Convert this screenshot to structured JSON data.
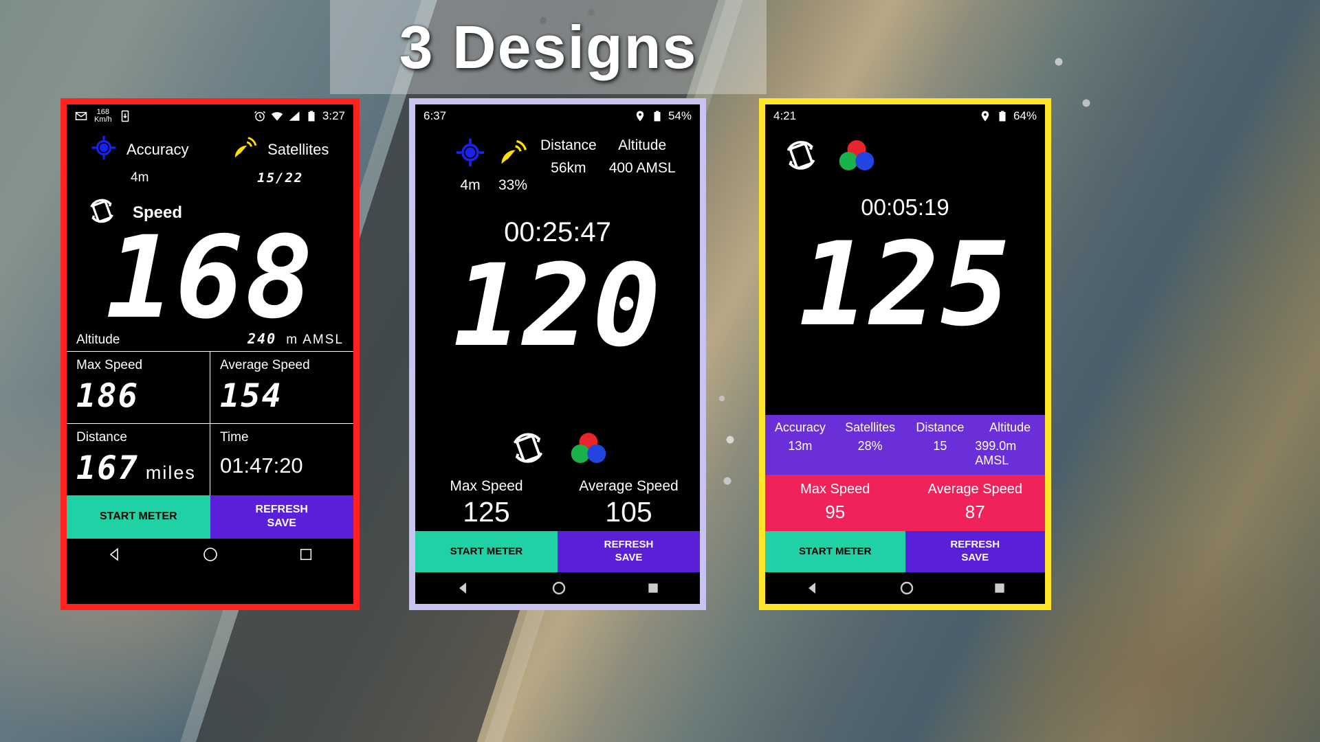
{
  "banner": {
    "title": "3 Designs"
  },
  "colors": {
    "phone1_frame": "#ff2320",
    "phone2_frame": "#c9c3f2",
    "phone3_frame": "#ffe428",
    "teal_button": "#1fd1a5",
    "purple_button": "#5a1fd8",
    "panel_purple": "#6a2fd8",
    "panel_pink": "#f0225a",
    "gps_blue": "#1a22f0",
    "satellite_yellow": "#ffe000"
  },
  "phone1": {
    "statusbar": {
      "mail_icon": "mail-icon",
      "speed_badge": "168",
      "speed_unit": "Km/h",
      "download_icon": "download-icon",
      "alarm_icon": "alarm-icon",
      "wifi_icon": "wifi-icon",
      "signal_icon": "signal-icon",
      "battery_icon": "battery-icon",
      "time": "3:27"
    },
    "accuracy": {
      "icon": "gps-target-icon",
      "label": "Accuracy",
      "value": "4m"
    },
    "satellites": {
      "icon": "satellite-dish-icon",
      "label": "Satellites",
      "value": "15/22"
    },
    "speed": {
      "icon": "rotate-device-icon",
      "label": "Speed",
      "value": "168"
    },
    "altitude": {
      "label": "Altitude",
      "value": "240",
      "unit": "m AMSL"
    },
    "stats": [
      {
        "label": "Max Speed",
        "value": "186",
        "unit": ""
      },
      {
        "label": "Average Speed",
        "value": "154",
        "unit": ""
      },
      {
        "label": "Distance",
        "value": "167",
        "unit": "miles"
      },
      {
        "label": "Time",
        "value": "01:47:20",
        "unit": ""
      }
    ],
    "buttons": [
      {
        "label": "START METER",
        "style": "teal"
      },
      {
        "label": "REFRESH\nSAVE",
        "line1": "REFRESH",
        "line2": "SAVE",
        "style": "purple"
      }
    ],
    "navbar": [
      "back-icon",
      "home-icon",
      "recents-icon"
    ]
  },
  "phone2": {
    "statusbar": {
      "time": "6:37",
      "location_icon": "location-pin-icon",
      "battery_icon": "battery-icon",
      "battery": "54%"
    },
    "accuracy": {
      "icon": "gps-target-icon",
      "value": "4m"
    },
    "satellites": {
      "icon": "satellite-dish-icon",
      "value": "33%"
    },
    "distance": {
      "label": "Distance",
      "value": "56km"
    },
    "altitude": {
      "label": "Altitude",
      "value": "400 AMSL"
    },
    "timer": "00:25:47",
    "speed": "120",
    "icons": {
      "rotate": "rotate-device-icon",
      "color_dots": "color-mode-icon"
    },
    "stats": [
      {
        "label": "Max Speed",
        "value": "125"
      },
      {
        "label": "Average Speed",
        "value": "105"
      }
    ],
    "buttons": [
      {
        "label": "START METER",
        "style": "teal"
      },
      {
        "line1": "REFRESH",
        "line2": "SAVE",
        "style": "purple"
      }
    ],
    "navbar": [
      "back-icon",
      "home-icon",
      "recents-icon"
    ]
  },
  "phone3": {
    "statusbar": {
      "time": "4:21",
      "location_icon": "location-pin-icon",
      "battery_icon": "battery-icon",
      "battery": "64%"
    },
    "icons": {
      "rotate": "rotate-device-icon",
      "color_dots": "color-mode-icon"
    },
    "timer": "00:05:19",
    "speed": "125",
    "info": [
      {
        "label": "Accuracy",
        "value": "13m"
      },
      {
        "label": "Satellites",
        "value": "28%"
      },
      {
        "label": "Distance",
        "value": "15"
      },
      {
        "label": "Altitude",
        "value": "399.0m AMSL"
      }
    ],
    "stats": [
      {
        "label": "Max Speed",
        "value": "95"
      },
      {
        "label": "Average Speed",
        "value": "87"
      }
    ],
    "buttons": [
      {
        "label": "START METER",
        "style": "teal"
      },
      {
        "line1": "REFRESH",
        "line2": "SAVE",
        "style": "purple"
      }
    ],
    "navbar": [
      "back-icon",
      "home-icon",
      "recents-icon"
    ]
  }
}
